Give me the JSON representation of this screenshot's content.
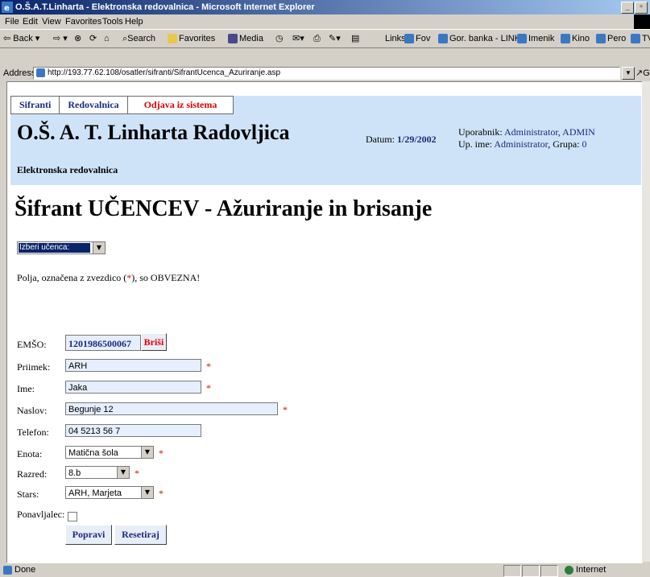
{
  "window": {
    "title": "O.Š.A.T.Linharta - Elektronska redovalnica - Microsoft Internet Explorer"
  },
  "menu": [
    "File",
    "Edit",
    "View",
    "Favorites",
    "Tools",
    "Help"
  ],
  "toolbar": {
    "back": "Back",
    "search": "Search",
    "favorites": "Favorites",
    "media": "Media",
    "links_label": "Links",
    "links": [
      "Fov",
      "Gor. banka - LINK",
      "Imenik",
      "Kino",
      "Pero",
      "TV"
    ]
  },
  "address": {
    "label": "Address",
    "url": "http://193.77.62.108/osatler/sifranti/SifrantUcenca_Azuriranje.asp",
    "go": "Go"
  },
  "nav": {
    "tabs": [
      "Sifranti",
      "Redovalnica",
      "Odjava iz sistema"
    ]
  },
  "header": {
    "school": "O.Š. A. T. Linharta Radovljica",
    "datum_label": "Datum:",
    "datum": "1/29/2002",
    "user_label": "Uporabnik:",
    "user": "Administrator, ADMIN",
    "upime_label": "Up. ime:",
    "upime": "Administrator",
    "grupa_label": ", Grupa:",
    "grupa": "0",
    "subtitle": "Elektronska redovalnica"
  },
  "page": {
    "title": "Šifrant UČENCEV - Ažuriranje in brisanje",
    "select_student": "Izberi učenca:",
    "note_before": "Polja, označena z zvezdico (",
    "note_star": "*",
    "note_after": "), so OBVEZNA!"
  },
  "form": {
    "emso_label": "EMŠO:",
    "emso": "1201986500067",
    "delete_button": "Briši",
    "priimek_label": "Priimek:",
    "priimek": "ARH",
    "ime_label": "Ime:",
    "ime": "Jaka",
    "naslov_label": "Naslov:",
    "naslov": "Begunje 12",
    "telefon_label": "Telefon:",
    "telefon": "04 5213 56 7",
    "enota_label": "Enota:",
    "enota": "Matična šola",
    "razred_label": "Razred:",
    "razred": "8.b",
    "stars_label": "Stars:",
    "stars": "ARH, Marjeta",
    "ponavljalec_label": "Ponavljalec:",
    "ponavljalec_checked": false,
    "required_mark": "*",
    "save_button": "Popravi",
    "reset_button": "Resetiraj"
  },
  "status": {
    "left": "Done",
    "zone": "Internet"
  }
}
